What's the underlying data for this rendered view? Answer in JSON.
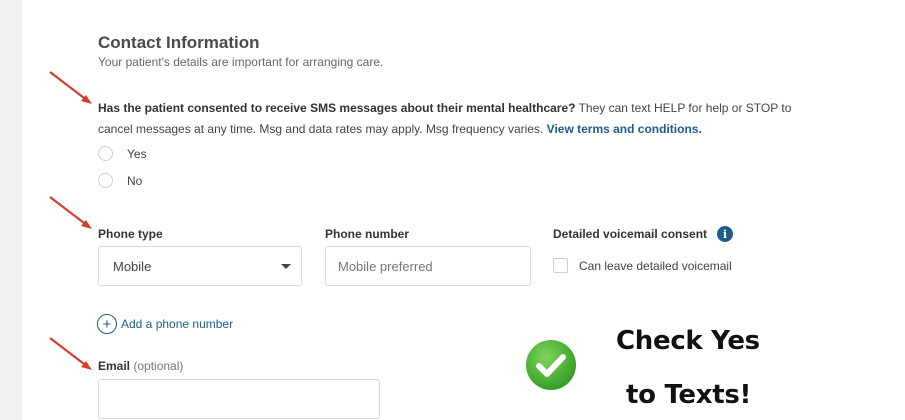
{
  "section": {
    "title": "Contact Information",
    "subtitle": "Your patient's details are important for arranging care."
  },
  "sms_consent": {
    "question": "Has the patient consented to receive SMS messages about their mental healthcare?",
    "details": " They can text HELP for help or STOP to cancel messages at any time. Msg and data rates may apply. Msg frequency varies. ",
    "terms_link": "View terms and conditions.",
    "options": [
      {
        "label": "Yes",
        "selected": false
      },
      {
        "label": "No",
        "selected": false
      }
    ]
  },
  "phone": {
    "type_label": "Phone type",
    "type_value": "Mobile",
    "number_label": "Phone number",
    "number_placeholder": "Mobile preferred",
    "voicemail_label": "Detailed voicemail consent",
    "voicemail_checkbox_label": "Can leave detailed voicemail",
    "voicemail_checked": false,
    "add_label": "Add a phone number"
  },
  "email": {
    "label": "Email",
    "optional": "(optional)",
    "value": ""
  },
  "callout": {
    "line1": "Check Yes",
    "line2": "to Texts!"
  },
  "colors": {
    "link": "#1f5c8b",
    "arrow": "#d2402c",
    "badge": "#3dac2e"
  },
  "icons": {
    "info": "info-icon",
    "add": "plus-circle-icon",
    "dropdown": "chevron-down-icon",
    "badge": "check-circle-icon"
  }
}
